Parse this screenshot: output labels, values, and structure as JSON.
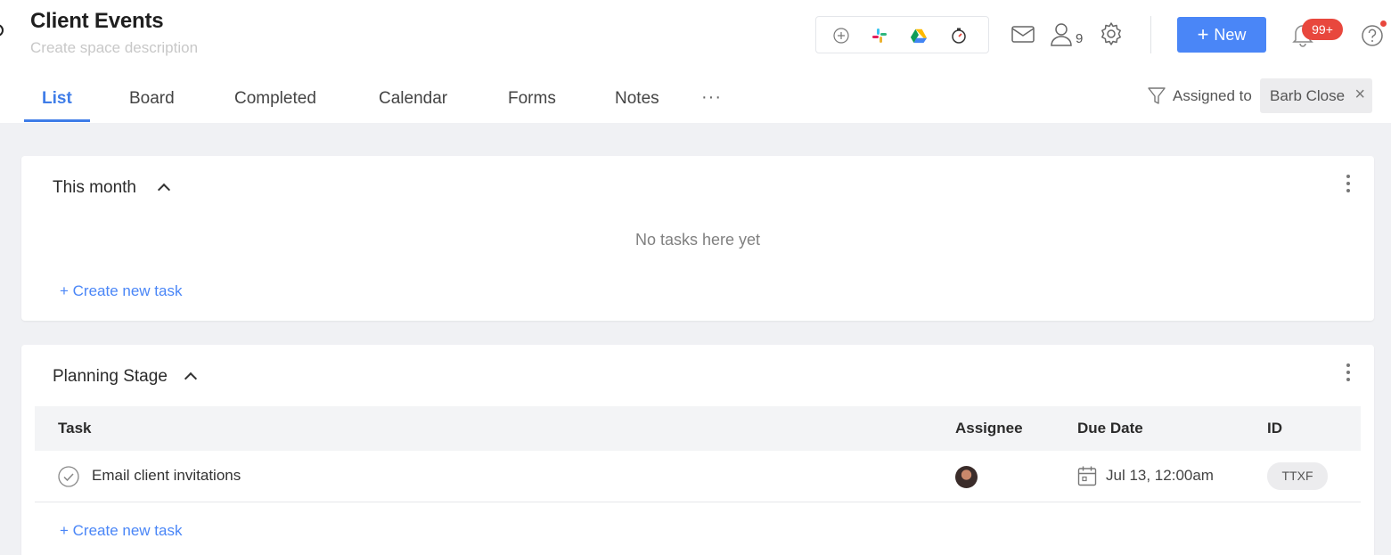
{
  "header": {
    "title": "Client Events",
    "description_placeholder": "Create space description",
    "integrations": [
      "add-integration-icon",
      "slack-icon",
      "google-drive-icon",
      "time-tracker-icon"
    ],
    "people_count": "9",
    "new_button_label": "New",
    "notification_badge": "99+",
    "icons": [
      "mail-icon",
      "people-icon",
      "gear-icon",
      "bell-icon",
      "help-icon"
    ]
  },
  "tabs": [
    {
      "label": "List",
      "active": true
    },
    {
      "label": "Board"
    },
    {
      "label": "Completed"
    },
    {
      "label": "Calendar"
    },
    {
      "label": "Forms"
    },
    {
      "label": "Notes"
    }
  ],
  "more_label": "···",
  "filter": {
    "label": "Assigned to",
    "value": "Barb Close",
    "clear": "×"
  },
  "sections": [
    {
      "title": "This month",
      "empty_message": "No tasks here yet",
      "create_label": "+ Create new task"
    },
    {
      "title": "Planning Stage",
      "columns": {
        "task": "Task",
        "assignee": "Assignee",
        "due": "Due Date",
        "id": "ID"
      },
      "tasks": [
        {
          "name": "Email client invitations",
          "due": "Jul 13, 12:00am",
          "id": "TTXF"
        }
      ],
      "create_label": "+ Create new task"
    }
  ],
  "colors": {
    "accent": "#4a86f7",
    "badge": "#e8473d",
    "background": "#f0f1f4"
  }
}
